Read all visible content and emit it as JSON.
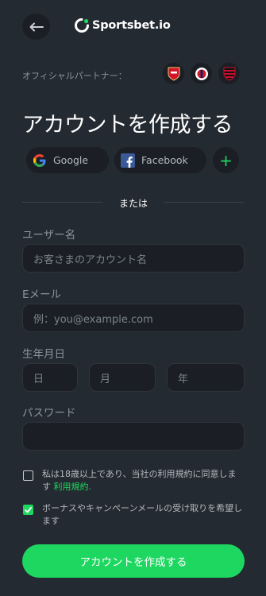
{
  "header": {
    "back_icon": "arrow-left-icon",
    "logo_text": "Sportsbet.io"
  },
  "partners": {
    "label": "オフィシャルパートナー：",
    "badges": [
      "Arsenal",
      "Southampton",
      "Flamengo"
    ]
  },
  "title": "アカウントを作成する",
  "social": {
    "google_label": "Google",
    "facebook_label": "Facebook",
    "more_label": "+"
  },
  "divider_text": "または",
  "form": {
    "username": {
      "label": "ユーザー名",
      "placeholder": "お客さまのアカウント名"
    },
    "email": {
      "label": "Eメール",
      "placeholder": "例：you@example.com"
    },
    "birthdate": {
      "label": "生年月日",
      "day": "日",
      "month": "月",
      "year": "年"
    },
    "password": {
      "label": "パスワード",
      "placeholder": ""
    }
  },
  "terms": {
    "checked": false,
    "text_before": "私は18歳以上であり、当社の利用規約に同意します",
    "link": "利用規約",
    "text_after": "."
  },
  "marketing": {
    "checked": true,
    "text": "ボーナスやキャンペーンメールの受け取りを希望します"
  },
  "submit_label": "アカウントを作成する",
  "colors": {
    "background": "#242a31",
    "field": "#1b1f25",
    "accent": "#1ed760"
  }
}
